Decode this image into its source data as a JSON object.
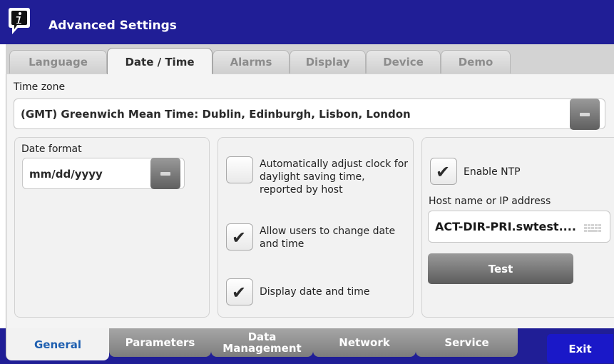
{
  "header": {
    "title": "Advanced Settings",
    "icon": "info-icon"
  },
  "top_tabs": [
    {
      "label": "Language",
      "active": false
    },
    {
      "label": "Date / Time",
      "active": true
    },
    {
      "label": "Alarms",
      "active": false
    },
    {
      "label": "Display",
      "active": false
    },
    {
      "label": "Device",
      "active": false
    },
    {
      "label": "Demo",
      "active": false
    }
  ],
  "timezone": {
    "label": "Time zone",
    "value": "(GMT) Greenwich Mean Time: Dublin, Edinburgh, Lisbon, London"
  },
  "date_format": {
    "label": "Date format",
    "value": "mm/dd/yyyy"
  },
  "options": {
    "auto_dst": {
      "label": "Automatically adjust clock for daylight saving time, reported by host",
      "checked": false
    },
    "allow_change": {
      "label": "Allow users to change date and time",
      "checked": true
    },
    "display_datetime": {
      "label": "Display date and time",
      "checked": true
    }
  },
  "ntp": {
    "enable_label": "Enable NTP",
    "enabled": true,
    "host_label": "Host name or IP address",
    "host_value": "ACT-DIR-PRI.swtest....",
    "test_label": "Test"
  },
  "bottom_tabs": [
    {
      "label": "General",
      "active": true
    },
    {
      "label": "Parameters",
      "active": false
    },
    {
      "label": "Data Management",
      "active": false
    },
    {
      "label": "Network",
      "active": false
    },
    {
      "label": "Service",
      "active": false
    }
  ],
  "exit_label": "Exit",
  "colors": {
    "header_bg": "#201e96",
    "exit_bg": "#1a18c8",
    "active_bottom_tab_text": "#1e5fb0"
  }
}
